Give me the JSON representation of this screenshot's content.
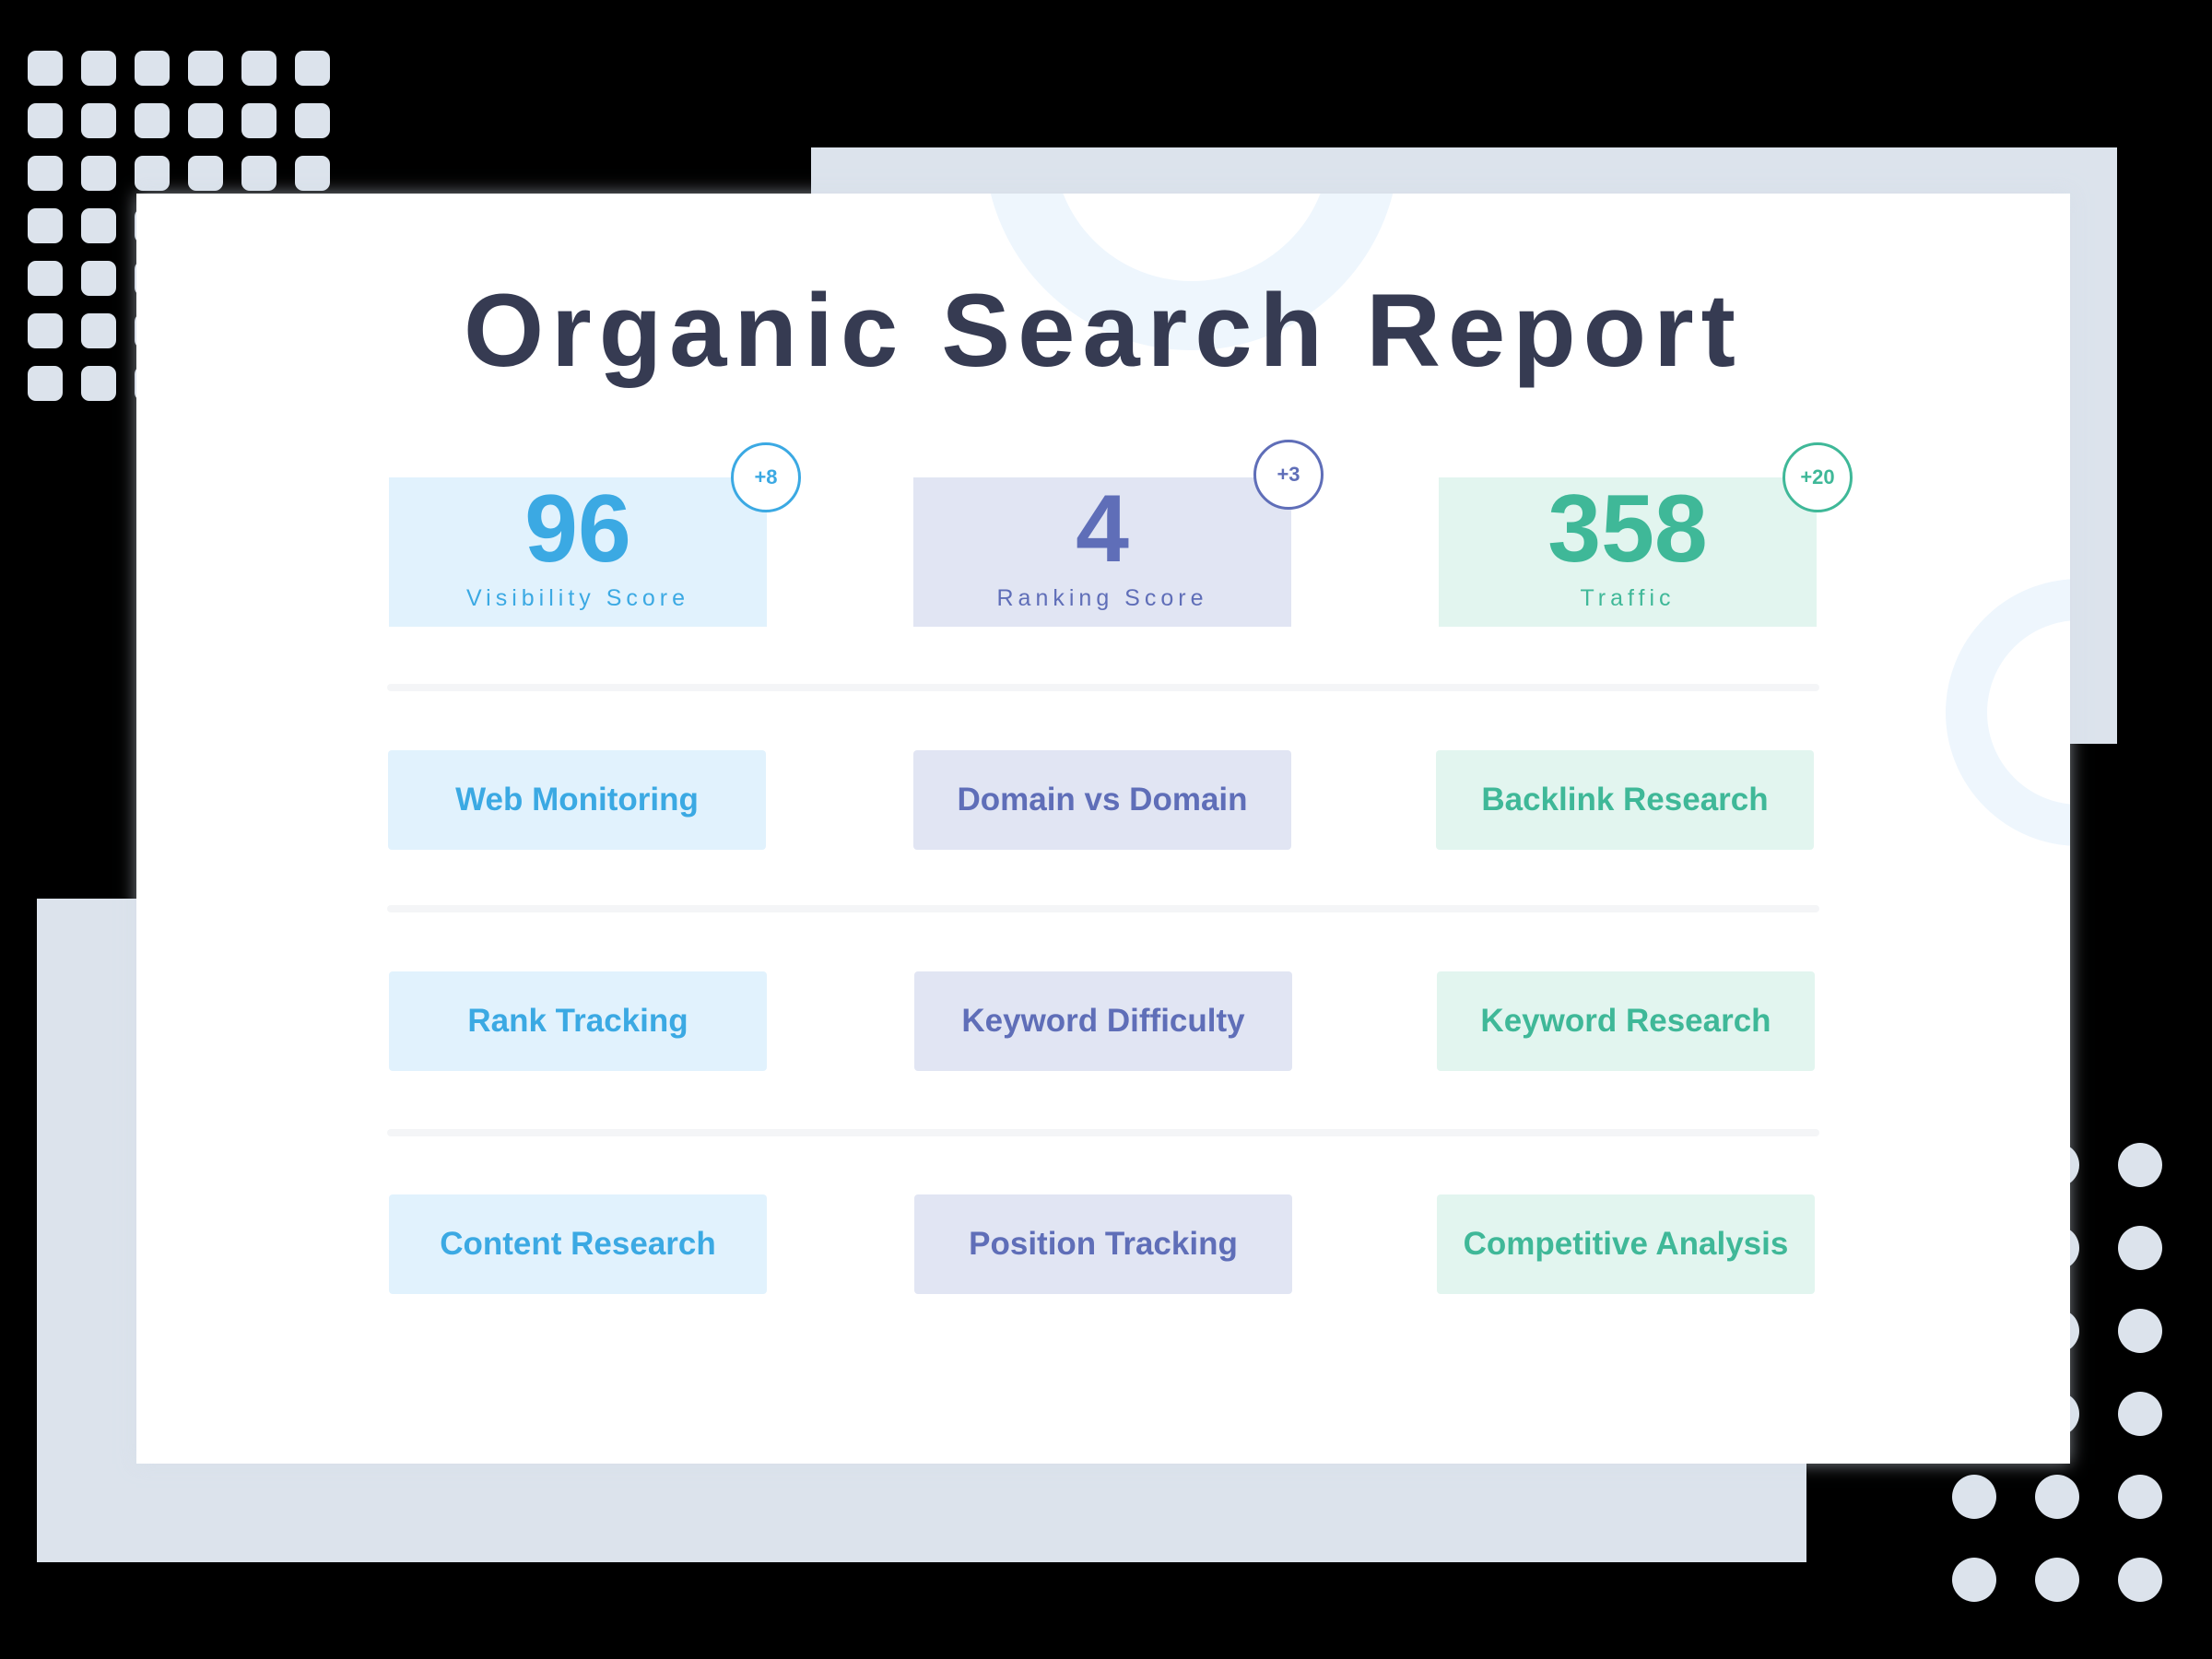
{
  "title": "Organic Search Report",
  "stats": [
    {
      "value": "96",
      "label": "Visibility Score",
      "badge": "+8",
      "accent": "#3ba9e3"
    },
    {
      "value": "4",
      "label": "Ranking Score",
      "badge": "+3",
      "accent": "#5f6eb8"
    },
    {
      "value": "358",
      "label": "Traffic",
      "badge": "+20",
      "accent": "#3fb898"
    }
  ],
  "tools": [
    [
      "Web Monitoring",
      "Domain vs Domain",
      "Backlink Research"
    ],
    [
      "Rank Tracking",
      "Keyword Difficulty",
      "Keyword Research"
    ],
    [
      "Content Research",
      "Position Tracking",
      "Competitive Analysis"
    ]
  ],
  "colors": {
    "title": "#363b52",
    "blue": "#3ba9e3",
    "indigo": "#5f6eb8",
    "teal": "#3fb898",
    "decor": "#dce3ec",
    "background": "#000000"
  }
}
